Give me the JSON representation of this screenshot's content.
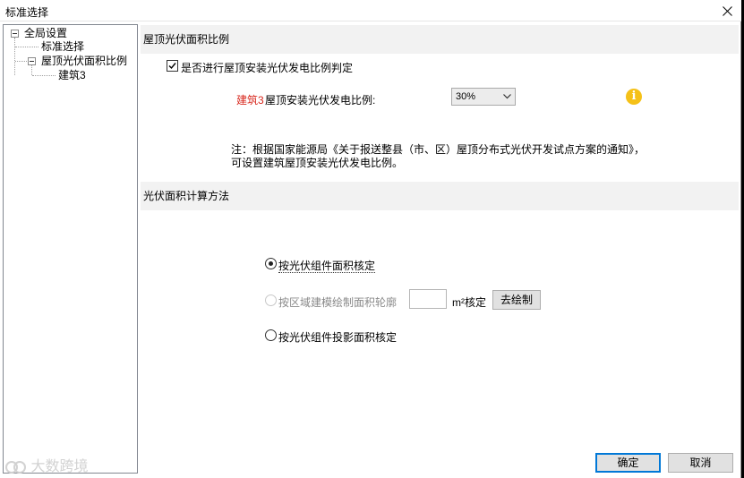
{
  "window": {
    "title": "标准选择",
    "close_icon": "close-icon"
  },
  "tree": {
    "items": [
      {
        "label": "全局设置"
      },
      {
        "label": "标准选择"
      },
      {
        "label": "屋顶光伏面积比例"
      },
      {
        "label": "建筑3"
      }
    ]
  },
  "section1": {
    "header": "屋顶光伏面积比例",
    "checkbox_label": "是否进行屋顶安装光伏发电比例判定",
    "checkbox_checked": true,
    "building_name": "建筑3",
    "ratio_label": "屋顶安装光伏发电比例:",
    "ratio_value": "30%",
    "note_line1": "注：根据国家能源局《关于报送整县（市、区）屋顶分布式光伏开发试点方案的通知》，",
    "note_line2": "可设置建筑屋顶安装光伏发电比例。"
  },
  "section2": {
    "header": "光伏面积计算方法",
    "option1": "按光伏组件面积核定",
    "option2": "按区域建模绘制面积轮廓",
    "option2_unit": "m²核定",
    "option2_button": "去绘制",
    "option2_input_value": "",
    "option3": "按光伏组件投影面积核定",
    "selected_option": 1
  },
  "footer": {
    "ok": "确定",
    "cancel": "取消"
  },
  "watermark": {
    "text": "大数跨境"
  },
  "colors": {
    "accent": "#0078d7",
    "info": "#f5c118",
    "highlight_red": "#d8281e",
    "section_bg": "#f2f2f2"
  }
}
